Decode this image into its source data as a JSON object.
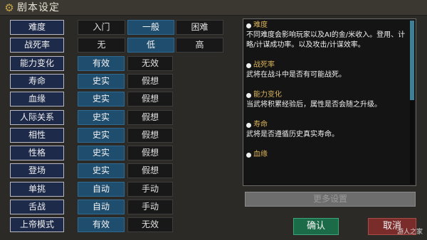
{
  "window": {
    "title": "剧本设定",
    "icon": "gear-icon",
    "title_color": "#c8a44a"
  },
  "settings": [
    {
      "label": "难度",
      "options": [
        "入门",
        "一般",
        "困难"
      ],
      "selected": 1
    },
    {
      "label": "战死率",
      "options": [
        "无",
        "低",
        "高"
      ],
      "selected": 1
    },
    {
      "label": "能力变化",
      "options": [
        "有效",
        "无效"
      ],
      "selected": 0
    },
    {
      "label": "寿命",
      "options": [
        "史实",
        "假想"
      ],
      "selected": 0
    },
    {
      "label": "血缘",
      "options": [
        "史实",
        "假想"
      ],
      "selected": 0
    },
    {
      "label": "人际关系",
      "options": [
        "史实",
        "假想"
      ],
      "selected": 0
    },
    {
      "label": "相性",
      "options": [
        "史实",
        "假想"
      ],
      "selected": 0
    },
    {
      "label": "性格",
      "options": [
        "史实",
        "假想"
      ],
      "selected": 0
    },
    {
      "label": "登场",
      "options": [
        "史实",
        "假想"
      ],
      "selected": 0
    },
    {
      "label": "单挑",
      "options": [
        "自动",
        "手动"
      ],
      "selected": 0
    },
    {
      "label": "舌战",
      "options": [
        "自动",
        "手动"
      ],
      "selected": 0
    },
    {
      "label": "上帝模式",
      "options": [
        "有效",
        "无效"
      ],
      "selected": 0
    }
  ],
  "description": {
    "sections": [
      {
        "heading": "难度",
        "body": "不同难度会影响玩家以及AI的金/米收入。登用、计略/计谋成功率。以及攻击/计谋效率。"
      },
      {
        "heading": "战死率",
        "body": "武将在战斗中是否有可能战死。"
      },
      {
        "heading": "能力变化",
        "body": "当武将积累经验后，属性是否会随之升级。"
      },
      {
        "heading": "寿命",
        "body": "武将是否遵循历史真实寿命。"
      },
      {
        "heading": "血缘",
        "body": ""
      }
    ],
    "scroll_fraction": 0.48
  },
  "buttons": {
    "more": "更多设置",
    "confirm": "确认",
    "cancel": "取消"
  },
  "watermark": "游人之家",
  "colors": {
    "selected": "#1f4d6e",
    "unselected": "#181818",
    "label_bg": "#1d2a4a",
    "heading": "#d9b25a",
    "confirm": "#1c6b48",
    "cancel": "#7a2c2a"
  }
}
